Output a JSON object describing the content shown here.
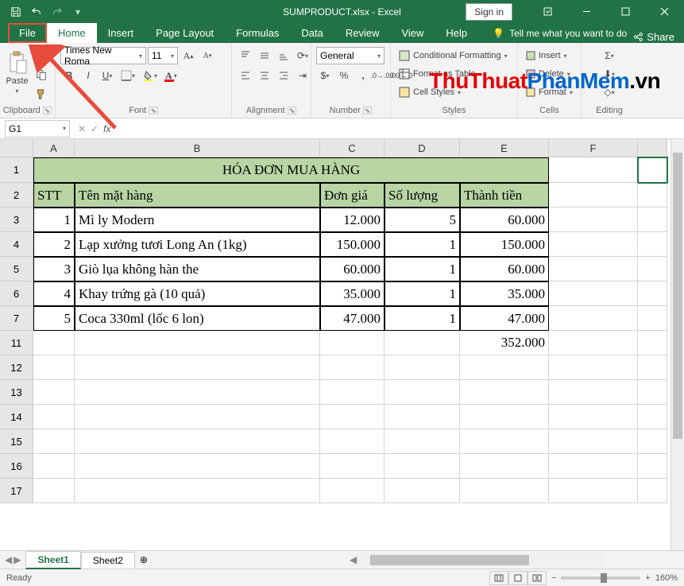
{
  "title": "SUMPRODUCT.xlsx - Excel",
  "signin": "Sign in",
  "tabs": {
    "file": "File",
    "home": "Home",
    "insert": "Insert",
    "page_layout": "Page Layout",
    "formulas": "Formulas",
    "data": "Data",
    "review": "Review",
    "view": "View",
    "help": "Help",
    "tellme": "Tell me what you want to do",
    "share": "Share"
  },
  "ribbon": {
    "clipboard": {
      "label": "Clipboard",
      "paste": "Paste"
    },
    "font": {
      "label": "Font",
      "name": "Times New Roma",
      "size": "11"
    },
    "alignment": {
      "label": "Alignment"
    },
    "number": {
      "label": "Number",
      "format": "General"
    },
    "styles": {
      "label": "Styles",
      "cond": "Conditional Formatting",
      "table": "Format as Table",
      "cell": "Cell Styles"
    },
    "cells": {
      "label": "Cells",
      "insert": "Insert",
      "delete": "Delete",
      "format": "Format"
    },
    "editing": {
      "label": "Editing"
    }
  },
  "watermark": {
    "p1": "ThuThuat",
    "p2": "PhanMem",
    "p3": ".vn"
  },
  "namebox": "G1",
  "fx": "fx",
  "columns": [
    "A",
    "B",
    "C",
    "D",
    "E",
    "F"
  ],
  "rows": [
    "1",
    "2",
    "3",
    "4",
    "5",
    "6",
    "7",
    "11",
    "12",
    "13",
    "14",
    "15",
    "16",
    "17"
  ],
  "table": {
    "title": "HÓA ĐƠN MUA HÀNG",
    "headers": {
      "stt": "STT",
      "ten": "Tên mặt hàng",
      "dongia": "Đơn giá",
      "soluong": "Số lượng",
      "thanhtien": "Thành tiền"
    },
    "rows": [
      {
        "stt": "1",
        "ten": "Mì ly Modern",
        "dongia": "12.000",
        "soluong": "5",
        "thanhtien": "60.000"
      },
      {
        "stt": "2",
        "ten": "Lạp xưởng tươi Long An (1kg)",
        "dongia": "150.000",
        "soluong": "1",
        "thanhtien": "150.000"
      },
      {
        "stt": "3",
        "ten": "Giò lụa không hàn the",
        "dongia": "60.000",
        "soluong": "1",
        "thanhtien": "60.000"
      },
      {
        "stt": "4",
        "ten": "Khay trứng gà (10 quả)",
        "dongia": "35.000",
        "soluong": "1",
        "thanhtien": "35.000"
      },
      {
        "stt": "5",
        "ten": "Coca 330ml (lốc 6 lon)",
        "dongia": "47.000",
        "soluong": "1",
        "thanhtien": "47.000"
      }
    ],
    "total": "352.000"
  },
  "sheets": {
    "s1": "Sheet1",
    "s2": "Sheet2"
  },
  "status": {
    "ready": "Ready",
    "zoom": "160%"
  }
}
